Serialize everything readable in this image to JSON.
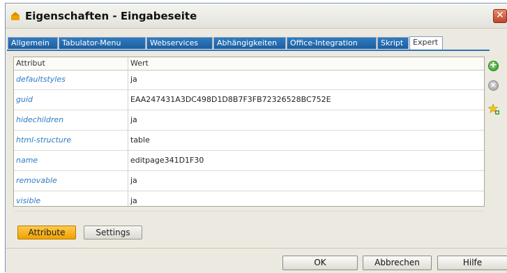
{
  "window": {
    "title": "Eigenschaften - Eingabeseite",
    "close_label": "✕"
  },
  "tabs": [
    {
      "label": "Allgemein",
      "active": false
    },
    {
      "label": "Tabulator-Menu",
      "active": false
    },
    {
      "label": "Webservices",
      "active": false
    },
    {
      "label": "Abhängigkeiten",
      "active": false
    },
    {
      "label": "Office-Integration",
      "active": false
    },
    {
      "label": "Skript",
      "active": false
    },
    {
      "label": "Expert",
      "active": true
    }
  ],
  "grid": {
    "columns": [
      "Attribut",
      "Wert"
    ],
    "rows": [
      {
        "attribute": "defaultstyles",
        "value": "ja"
      },
      {
        "attribute": "guid",
        "value": "EAA247431A3DC498D1D8B7F3FB72326528BC752E"
      },
      {
        "attribute": "hidechildren",
        "value": "ja"
      },
      {
        "attribute": "html-structure",
        "value": "table"
      },
      {
        "attribute": "name",
        "value": "editpage341D1F30"
      },
      {
        "attribute": "removable",
        "value": "ja"
      },
      {
        "attribute": "visible",
        "value": "ja"
      }
    ]
  },
  "side_tools": {
    "add_icon": "plus-circle-icon",
    "remove_icon": "x-circle-icon",
    "star_icon": "star-add-icon"
  },
  "bottom_tabs": {
    "attribute_label": "Attribute",
    "settings_label": "Settings"
  },
  "buttons": {
    "ok": "OK",
    "cancel": "Abbrechen",
    "help": "Hilfe"
  },
  "colors": {
    "tab_bg": "#1d5e9e",
    "attr_text": "#2d7bc4",
    "active_bottom_tab": "#f0a100",
    "close_btn": "#c0462a"
  }
}
